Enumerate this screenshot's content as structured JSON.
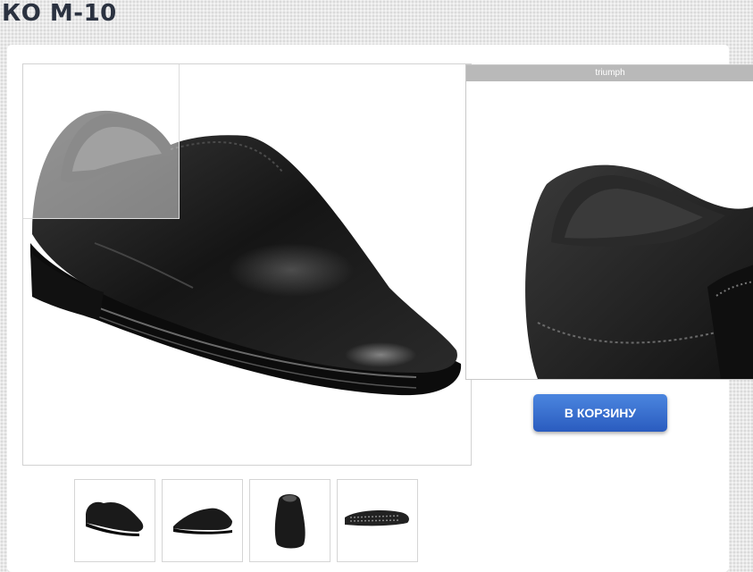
{
  "product": {
    "title": "КО М-10",
    "brand_caption": "triumph"
  },
  "actions": {
    "add_to_cart": "В КОРЗИНУ"
  },
  "gallery": {
    "thumbnails": [
      {
        "view": "shoe side-front view"
      },
      {
        "view": "shoe side view"
      },
      {
        "view": "shoe front view"
      },
      {
        "view": "shoe sole view"
      }
    ]
  },
  "colors": {
    "button": "#3a70d0",
    "title": "#2b3240",
    "shoe": "#151515"
  }
}
